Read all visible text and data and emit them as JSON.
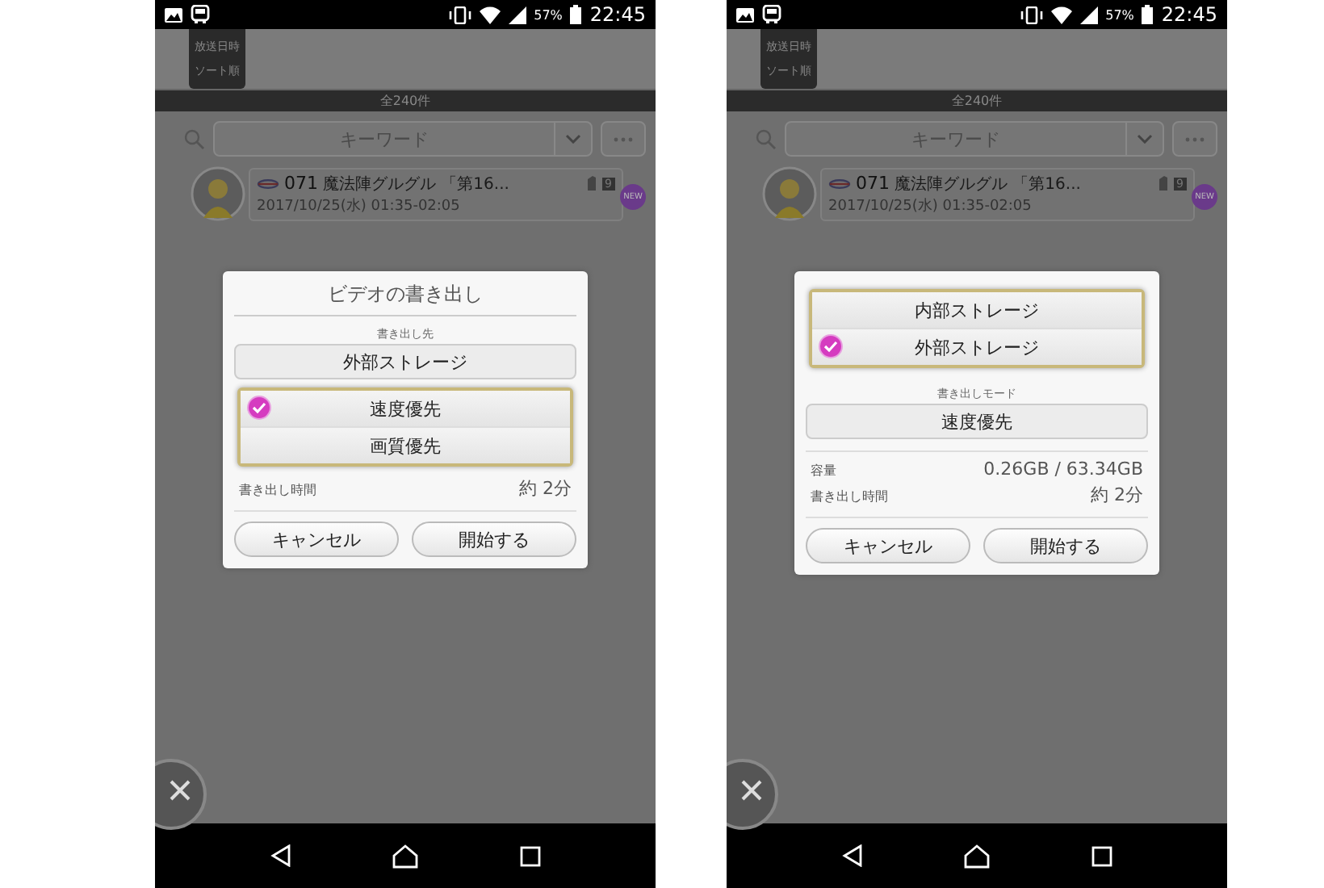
{
  "phones": [
    {
      "status_bar": {
        "battery": "57%",
        "time": "22:45"
      },
      "sort_tab": [
        "放送日時",
        "ソート順"
      ],
      "count": "全240件",
      "search": {
        "placeholder": "キーワード"
      },
      "program": {
        "number": "071",
        "title": "魔法陣グルグル 「第16...",
        "badge": "9",
        "new_badge": "NEW",
        "date": "2017/10/25(水) 01:35-02:05"
      },
      "dialog": {
        "items": [
          {
            "kind": "heading",
            "text": "ビデオの書き出し"
          },
          {
            "kind": "caption",
            "text": "書き出し先"
          },
          {
            "kind": "select",
            "text": "外部ストレージ"
          },
          {
            "kind": "options",
            "options": [
              {
                "label": "速度優先",
                "selected": true
              },
              {
                "label": "画質優先",
                "selected": false
              }
            ]
          },
          {
            "kind": "info",
            "label": "書き出し時間",
            "value": "約 2分"
          }
        ],
        "buttons": [
          "キャンセル",
          "開始する"
        ]
      }
    },
    {
      "status_bar": {
        "battery": "57%",
        "time": "22:45"
      },
      "sort_tab": [
        "放送日時",
        "ソート順"
      ],
      "count": "全240件",
      "search": {
        "placeholder": "キーワード"
      },
      "program": {
        "number": "071",
        "title": "魔法陣グルグル 「第16...",
        "badge": "9",
        "new_badge": "NEW",
        "date": "2017/10/25(水) 01:35-02:05"
      },
      "dialog": {
        "items": [
          {
            "kind": "options",
            "options": [
              {
                "label": "内部ストレージ",
                "selected": false
              },
              {
                "label": "外部ストレージ",
                "selected": true
              }
            ]
          },
          {
            "kind": "caption",
            "text": "書き出しモード"
          },
          {
            "kind": "select",
            "text": "速度優先"
          },
          {
            "kind": "divider"
          },
          {
            "kind": "info",
            "label": "容量",
            "value": "0.26GB / 63.34GB"
          },
          {
            "kind": "info",
            "label": "書き出し時間",
            "value": "約 2分"
          }
        ],
        "buttons": [
          "キャンセル",
          "開始する"
        ]
      }
    }
  ]
}
